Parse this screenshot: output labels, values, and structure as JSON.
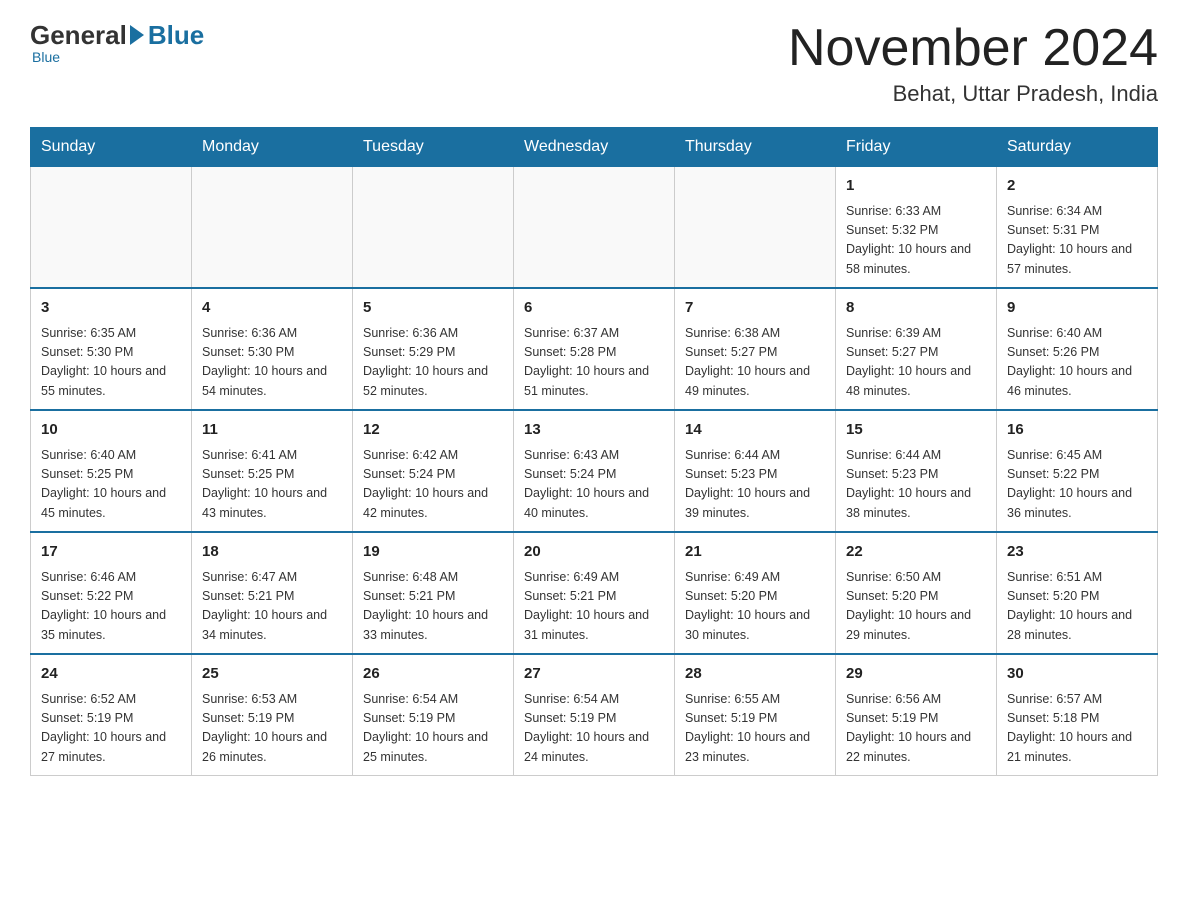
{
  "header": {
    "logo_general": "General",
    "logo_blue": "Blue",
    "month_title": "November 2024",
    "location": "Behat, Uttar Pradesh, India"
  },
  "weekdays": [
    "Sunday",
    "Monday",
    "Tuesday",
    "Wednesday",
    "Thursday",
    "Friday",
    "Saturday"
  ],
  "weeks": [
    [
      {
        "day": "",
        "info": ""
      },
      {
        "day": "",
        "info": ""
      },
      {
        "day": "",
        "info": ""
      },
      {
        "day": "",
        "info": ""
      },
      {
        "day": "",
        "info": ""
      },
      {
        "day": "1",
        "info": "Sunrise: 6:33 AM\nSunset: 5:32 PM\nDaylight: 10 hours and 58 minutes."
      },
      {
        "day": "2",
        "info": "Sunrise: 6:34 AM\nSunset: 5:31 PM\nDaylight: 10 hours and 57 minutes."
      }
    ],
    [
      {
        "day": "3",
        "info": "Sunrise: 6:35 AM\nSunset: 5:30 PM\nDaylight: 10 hours and 55 minutes."
      },
      {
        "day": "4",
        "info": "Sunrise: 6:36 AM\nSunset: 5:30 PM\nDaylight: 10 hours and 54 minutes."
      },
      {
        "day": "5",
        "info": "Sunrise: 6:36 AM\nSunset: 5:29 PM\nDaylight: 10 hours and 52 minutes."
      },
      {
        "day": "6",
        "info": "Sunrise: 6:37 AM\nSunset: 5:28 PM\nDaylight: 10 hours and 51 minutes."
      },
      {
        "day": "7",
        "info": "Sunrise: 6:38 AM\nSunset: 5:27 PM\nDaylight: 10 hours and 49 minutes."
      },
      {
        "day": "8",
        "info": "Sunrise: 6:39 AM\nSunset: 5:27 PM\nDaylight: 10 hours and 48 minutes."
      },
      {
        "day": "9",
        "info": "Sunrise: 6:40 AM\nSunset: 5:26 PM\nDaylight: 10 hours and 46 minutes."
      }
    ],
    [
      {
        "day": "10",
        "info": "Sunrise: 6:40 AM\nSunset: 5:25 PM\nDaylight: 10 hours and 45 minutes."
      },
      {
        "day": "11",
        "info": "Sunrise: 6:41 AM\nSunset: 5:25 PM\nDaylight: 10 hours and 43 minutes."
      },
      {
        "day": "12",
        "info": "Sunrise: 6:42 AM\nSunset: 5:24 PM\nDaylight: 10 hours and 42 minutes."
      },
      {
        "day": "13",
        "info": "Sunrise: 6:43 AM\nSunset: 5:24 PM\nDaylight: 10 hours and 40 minutes."
      },
      {
        "day": "14",
        "info": "Sunrise: 6:44 AM\nSunset: 5:23 PM\nDaylight: 10 hours and 39 minutes."
      },
      {
        "day": "15",
        "info": "Sunrise: 6:44 AM\nSunset: 5:23 PM\nDaylight: 10 hours and 38 minutes."
      },
      {
        "day": "16",
        "info": "Sunrise: 6:45 AM\nSunset: 5:22 PM\nDaylight: 10 hours and 36 minutes."
      }
    ],
    [
      {
        "day": "17",
        "info": "Sunrise: 6:46 AM\nSunset: 5:22 PM\nDaylight: 10 hours and 35 minutes."
      },
      {
        "day": "18",
        "info": "Sunrise: 6:47 AM\nSunset: 5:21 PM\nDaylight: 10 hours and 34 minutes."
      },
      {
        "day": "19",
        "info": "Sunrise: 6:48 AM\nSunset: 5:21 PM\nDaylight: 10 hours and 33 minutes."
      },
      {
        "day": "20",
        "info": "Sunrise: 6:49 AM\nSunset: 5:21 PM\nDaylight: 10 hours and 31 minutes."
      },
      {
        "day": "21",
        "info": "Sunrise: 6:49 AM\nSunset: 5:20 PM\nDaylight: 10 hours and 30 minutes."
      },
      {
        "day": "22",
        "info": "Sunrise: 6:50 AM\nSunset: 5:20 PM\nDaylight: 10 hours and 29 minutes."
      },
      {
        "day": "23",
        "info": "Sunrise: 6:51 AM\nSunset: 5:20 PM\nDaylight: 10 hours and 28 minutes."
      }
    ],
    [
      {
        "day": "24",
        "info": "Sunrise: 6:52 AM\nSunset: 5:19 PM\nDaylight: 10 hours and 27 minutes."
      },
      {
        "day": "25",
        "info": "Sunrise: 6:53 AM\nSunset: 5:19 PM\nDaylight: 10 hours and 26 minutes."
      },
      {
        "day": "26",
        "info": "Sunrise: 6:54 AM\nSunset: 5:19 PM\nDaylight: 10 hours and 25 minutes."
      },
      {
        "day": "27",
        "info": "Sunrise: 6:54 AM\nSunset: 5:19 PM\nDaylight: 10 hours and 24 minutes."
      },
      {
        "day": "28",
        "info": "Sunrise: 6:55 AM\nSunset: 5:19 PM\nDaylight: 10 hours and 23 minutes."
      },
      {
        "day": "29",
        "info": "Sunrise: 6:56 AM\nSunset: 5:19 PM\nDaylight: 10 hours and 22 minutes."
      },
      {
        "day": "30",
        "info": "Sunrise: 6:57 AM\nSunset: 5:18 PM\nDaylight: 10 hours and 21 minutes."
      }
    ]
  ]
}
